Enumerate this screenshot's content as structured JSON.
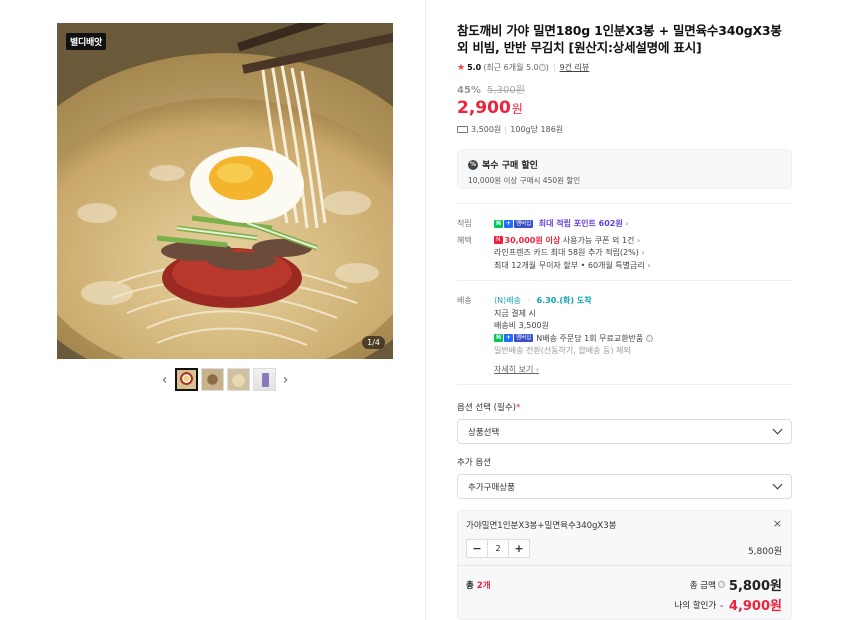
{
  "gallery": {
    "badge": "별디배앗",
    "counter": "1/4",
    "prev_arrow": "‹",
    "next_arrow": "›",
    "thumbnails": [
      "thumb-1",
      "thumb-2",
      "thumb-3",
      "thumb-4"
    ]
  },
  "product": {
    "title": "참도깨비 가야 밀면180g 1인분X3봉 + 밀면육수340gX3봉 외 비빔, 반반 무김치 [원산지:상세설명에 표시]",
    "star": "★",
    "rating": "5.0",
    "rating_note": "(최근 6개월 5.0",
    "rating_info": "ⓘ",
    "rating_close": ")",
    "review_link": "9건 리뷰",
    "discount": "45%",
    "original_price": "5,300원",
    "price": "2,900",
    "price_unit": "원",
    "shipping_fee_short": "3,500원",
    "unit_price": "100g당 186원"
  },
  "bulk": {
    "icon": "%",
    "title": "복수 구매 할인",
    "desc": "10,000원 이상 구매시 450원 할인"
  },
  "benefits": {
    "points_label": "적립",
    "points_text": "최대 적립 포인트 602원",
    "benefit_label": "혜택",
    "coupon_badge": "N",
    "coupon_highlight": "30,000원 이상",
    "coupon_text": "사용가능 쿠폰 외 1건",
    "card_text": "라인프렌즈 카드 최대 58원 추가 적립(2%)",
    "installment_text": "최대 12개월 무이자 할부 • 60개월 특별금리",
    "chevron": "›",
    "n_badge": "N",
    "plus_badge": "+",
    "member_badge": "멤버십"
  },
  "shipping": {
    "label": "배송",
    "type": "배송",
    "arrival": "6.30.(화) 도착",
    "pay_when": "지금 결제 시",
    "fee": "배송비 3,500원",
    "exchange": "N배송 주문당 1회 무료교환반품",
    "info": "ⓘ",
    "general": "일반배송 전환(선동하기, 합배송 등) 제외",
    "detail_link": "자세히 보기"
  },
  "options": {
    "required_label": "옵션 선택 (필수)",
    "required_mark": "*",
    "required_value": "상품선택",
    "extra_label": "추가 옵션",
    "extra_value": "추가구매상품"
  },
  "cart": {
    "item_name": "가야밀면1인분X3봉+밀면육수340gX3봉",
    "close": "×",
    "minus": "−",
    "qty": "2",
    "plus": "+",
    "item_price": "5,800원",
    "total_label": "총",
    "total_count": "2개",
    "total_amount_label": "총 금액",
    "total_amount_info": "ⓘ",
    "total_amount": "5,800원",
    "my_price_label": "나의 할인가",
    "my_price_chev": "⌄",
    "my_price": "4,900원"
  }
}
